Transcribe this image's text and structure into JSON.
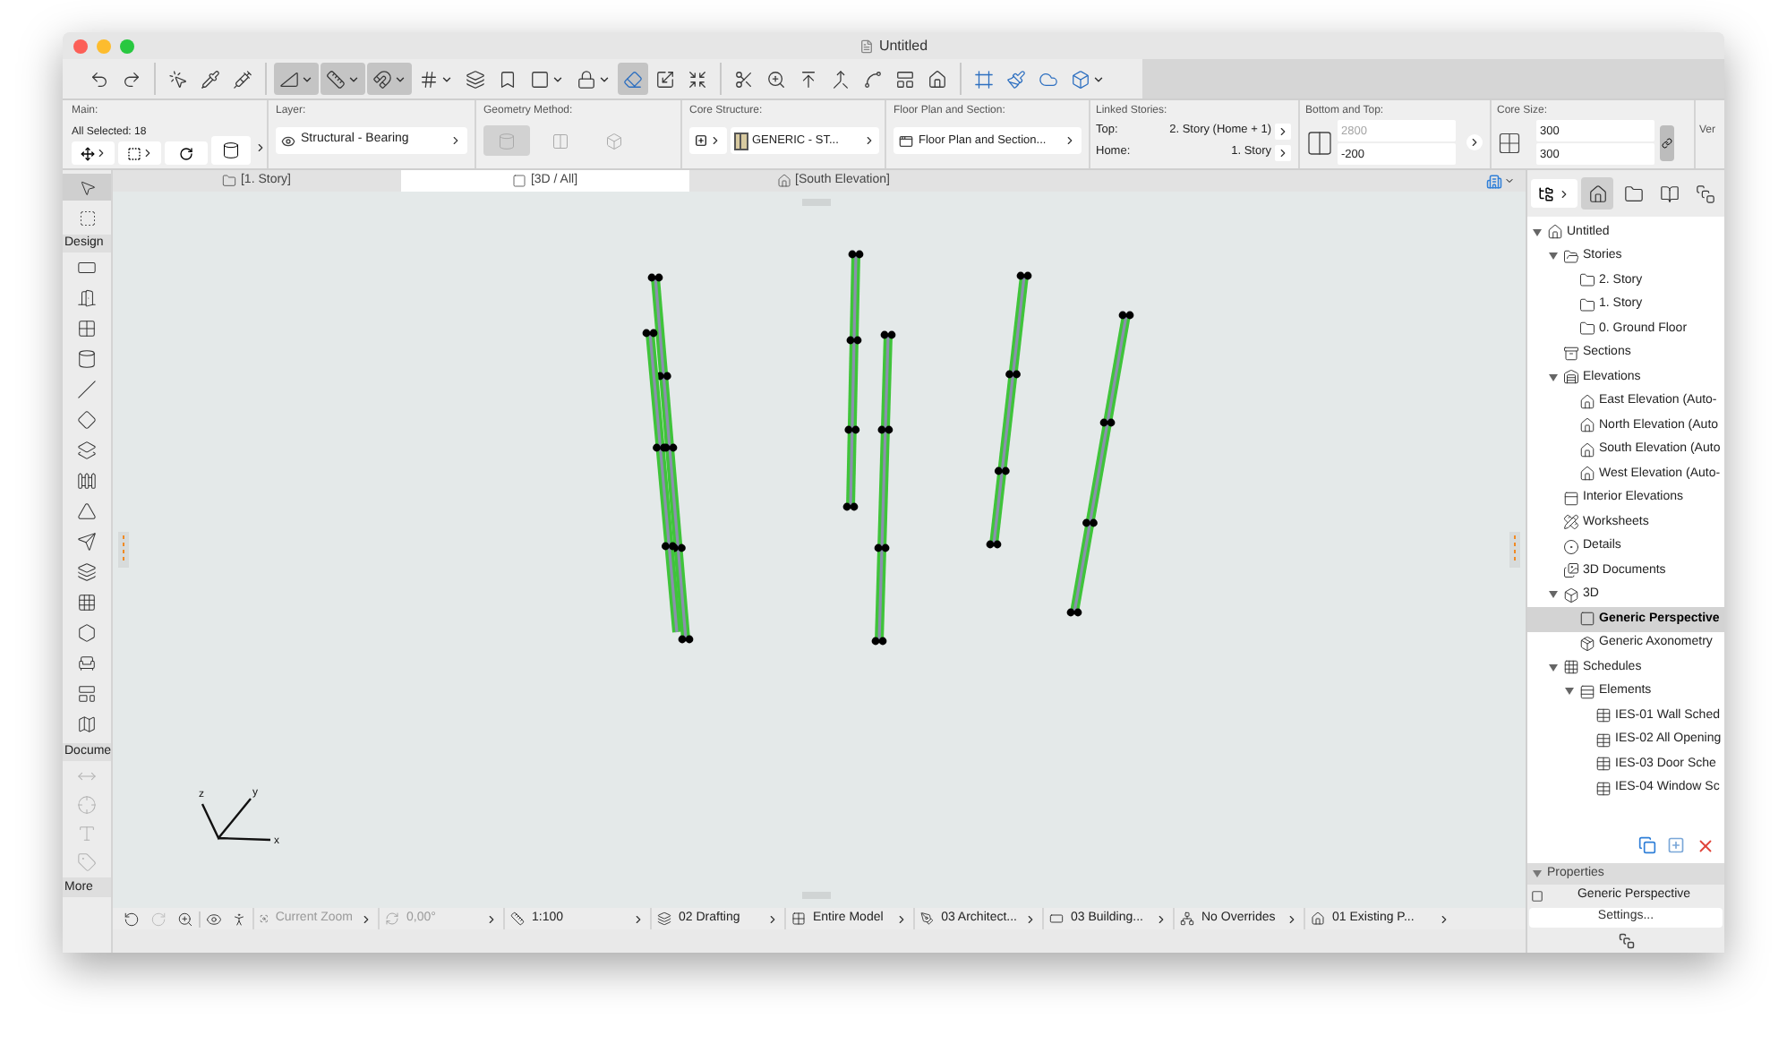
{
  "window": {
    "title": "Untitled"
  },
  "toolbar": {
    "groups": [
      [
        {
          "selected": false,
          "menu": false
        },
        {
          "selected": false,
          "menu": false
        }
      ],
      [
        {
          "selected": false,
          "menu": false
        },
        {
          "selected": false,
          "menu": false
        },
        {
          "selected": false,
          "menu": false
        }
      ],
      [
        {
          "selected": true,
          "menu": true
        },
        {
          "selected": true,
          "menu": true
        },
        {
          "selected": true,
          "menu": true
        },
        {
          "selected": false,
          "menu": true
        },
        {
          "selected": false,
          "menu": false
        },
        {
          "selected": false,
          "menu": false
        },
        {
          "selected": false,
          "menu": true
        },
        {
          "selected": false,
          "menu": true
        },
        {
          "selected": true,
          "menu": false
        },
        {
          "selected": false,
          "menu": false
        },
        {
          "selected": false,
          "menu": false
        }
      ],
      [
        {
          "selected": false,
          "menu": false
        },
        {
          "selected": false,
          "menu": false
        },
        {
          "selected": false,
          "menu": false
        },
        {
          "selected": false,
          "menu": false
        },
        {
          "selected": false,
          "menu": false
        },
        {
          "selected": false,
          "menu": false
        },
        {
          "selected": false,
          "menu": false
        }
      ],
      [
        {
          "selected": false,
          "menu": false
        },
        {
          "selected": false,
          "menu": false
        },
        {
          "selected": false,
          "menu": false
        },
        {
          "selected": false,
          "menu": true
        }
      ]
    ]
  },
  "info_box": {
    "main": {
      "label": "Main:",
      "selection": "All Selected: 18"
    },
    "layer": {
      "label": "Layer:",
      "value": "Structural - Bearing"
    },
    "geometry_method": {
      "label": "Geometry Method:",
      "options": [
        {
          "selected": true
        },
        {
          "selected": false
        },
        {
          "selected": false
        }
      ]
    },
    "core_structure": {
      "label": "Core Structure:",
      "value": "GENERIC - ST..."
    },
    "floor_plan_and_section": {
      "label": "Floor Plan and Section:",
      "value": "Floor Plan and Section..."
    },
    "linked_stories": {
      "label": "Linked Stories:",
      "rows": [
        {
          "name": "Top:",
          "value": "2. Story (Home + 1)"
        },
        {
          "name": "Home:",
          "value": "1. Story"
        }
      ]
    },
    "bottom_and_top": {
      "label": "Bottom and Top:",
      "fields": [
        {
          "value": "2800",
          "disabled": true
        },
        {
          "value": "-200",
          "disabled": false
        }
      ]
    },
    "core_size": {
      "label": "Core Size:",
      "fields": [
        "300",
        "300"
      ]
    },
    "column_9": {
      "label": "Ver"
    }
  },
  "tabs": [
    {
      "label": "[1. Story]",
      "selected": false
    },
    {
      "label": "[3D / All]",
      "selected": true
    },
    {
      "label": "[South Elevation]",
      "selected": false
    }
  ],
  "toolbox": {
    "pointer_tools": [
      {
        "selected": true
      },
      {
        "selected": false
      }
    ],
    "sections": [
      {
        "label": "Design",
        "tools": [
          {
            "disabled": false
          },
          {
            "disabled": false
          },
          {
            "disabled": false
          },
          {
            "disabled": false
          },
          {
            "disabled": false
          },
          {
            "disabled": false
          },
          {
            "disabled": false
          },
          {
            "disabled": false
          },
          {
            "disabled": false
          },
          {
            "disabled": false
          },
          {
            "disabled": false
          },
          {
            "disabled": false
          },
          {
            "disabled": false
          },
          {
            "disabled": false
          },
          {
            "disabled": false
          },
          {
            "disabled": false
          }
        ]
      },
      {
        "label": "Docume",
        "tools": [
          {
            "disabled": true
          },
          {
            "disabled": true
          },
          {
            "disabled": true
          },
          {
            "disabled": true
          }
        ]
      }
    ],
    "more": "More"
  },
  "canvas": {
    "axes": [
      "z",
      "y",
      "x"
    ]
  },
  "navigator": {
    "view_buttons": [
      {
        "selected": true
      },
      {
        "selected": false
      },
      {
        "selected": false
      },
      {
        "selected": false
      }
    ],
    "tree": [
      {
        "kind": "project",
        "label": "Untitled",
        "selected": false,
        "expanded": true,
        "children": [
          {
            "kind": "stories",
            "label": "Stories",
            "selected": false,
            "expanded": true,
            "children": [
              {
                "kind": "story",
                "label": "2. Story",
                "selected": false
              },
              {
                "kind": "story",
                "label": "1. Story",
                "selected": false
              },
              {
                "kind": "story",
                "label": "0. Ground Floor",
                "selected": false
              }
            ]
          },
          {
            "kind": "sections",
            "label": "Sections",
            "selected": false
          },
          {
            "kind": "elevations",
            "label": "Elevations",
            "selected": false,
            "expanded": true,
            "children": [
              {
                "kind": "elevation",
                "label": "East Elevation (Auto-",
                "selected": false
              },
              {
                "kind": "elevation",
                "label": "North Elevation (Auto",
                "selected": false
              },
              {
                "kind": "elevation",
                "label": "South Elevation (Auto",
                "selected": false
              },
              {
                "kind": "elevation",
                "label": "West Elevation (Auto-",
                "selected": false
              }
            ]
          },
          {
            "kind": "interior",
            "label": "Interior Elevations",
            "selected": false
          },
          {
            "kind": "worksheets",
            "label": "Worksheets",
            "selected": false
          },
          {
            "kind": "details",
            "label": "Details",
            "selected": false
          },
          {
            "kind": "documents",
            "label": "3D Documents",
            "selected": false
          },
          {
            "kind": "model",
            "label": "3D",
            "selected": false,
            "expanded": true,
            "children": [
              {
                "kind": "perspective",
                "label": "Generic Perspective",
                "selected": true
              },
              {
                "kind": "axonometry",
                "label": "Generic Axonometry",
                "selected": false
              }
            ]
          },
          {
            "kind": "schedules",
            "label": "Schedules",
            "selected": false,
            "expanded": true,
            "children": [
              {
                "kind": "elements",
                "label": "Elements",
                "selected": false,
                "expanded": true,
                "children": [
                  {
                    "kind": "schedule",
                    "label": "IES-01 Wall Sched",
                    "selected": false
                  },
                  {
                    "kind": "schedule",
                    "label": "IES-02 All Opening",
                    "selected": false
                  },
                  {
                    "kind": "schedule",
                    "label": "IES-03 Door Sche",
                    "selected": false
                  },
                  {
                    "kind": "schedule",
                    "label": "IES-04 Window Sc",
                    "selected": false
                  }
                ]
              }
            ]
          }
        ]
      }
    ],
    "properties": {
      "title": "Properties",
      "expanded": true,
      "view": "Generic Perspective",
      "button": "Settings..."
    }
  },
  "status_bar": {
    "nav_tools": [
      {
        "disabled": false
      },
      {
        "disabled": true
      },
      {
        "disabled": false
      },
      {
        "disabled": false
      },
      {
        "disabled": false
      }
    ],
    "items": [
      {
        "label": "Current Zoom",
        "disabled": true
      },
      {
        "label": "0,00°",
        "disabled": true
      },
      {
        "label": "1:100",
        "disabled": false
      },
      {
        "label": "02 Drafting",
        "disabled": false
      },
      {
        "label": "Entire Model",
        "disabled": false
      },
      {
        "label": "03 Architect...",
        "disabled": false
      },
      {
        "label": "03 Building...",
        "disabled": false
      },
      {
        "label": "No Overrides",
        "disabled": false
      },
      {
        "label": "01 Existing P...",
        "disabled": false
      }
    ]
  }
}
